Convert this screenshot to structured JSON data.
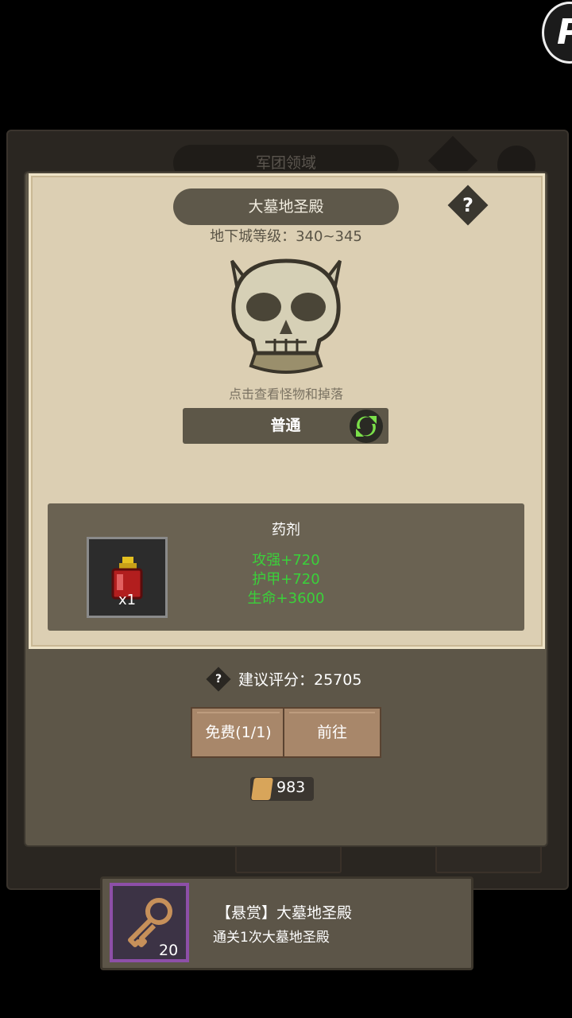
{
  "background": {
    "title": "军团领域"
  },
  "dialog": {
    "title": "大墓地圣殿",
    "help": "?",
    "dungeon_level": "地下城等级：340~345",
    "hint": "点击查看怪物和掉落",
    "difficulty": "普通",
    "reward": {
      "title": "药剂",
      "item_count": "x1",
      "stats": [
        "攻强+720",
        "护甲+720",
        "生命+3600"
      ]
    },
    "score": {
      "help": "?",
      "label": "建议评分：25705"
    },
    "buttons": {
      "free": "免费(1/1)",
      "go": "前往"
    },
    "currency": "983"
  },
  "bounty": {
    "key_count": "20",
    "title": "【悬赏】大墓地圣殿",
    "desc": "通关1次大墓地圣殿"
  },
  "colors": {
    "stat_green": "#3ad13a",
    "parchment": "#dccfb3",
    "bounty_border": "#8d4fa8"
  }
}
